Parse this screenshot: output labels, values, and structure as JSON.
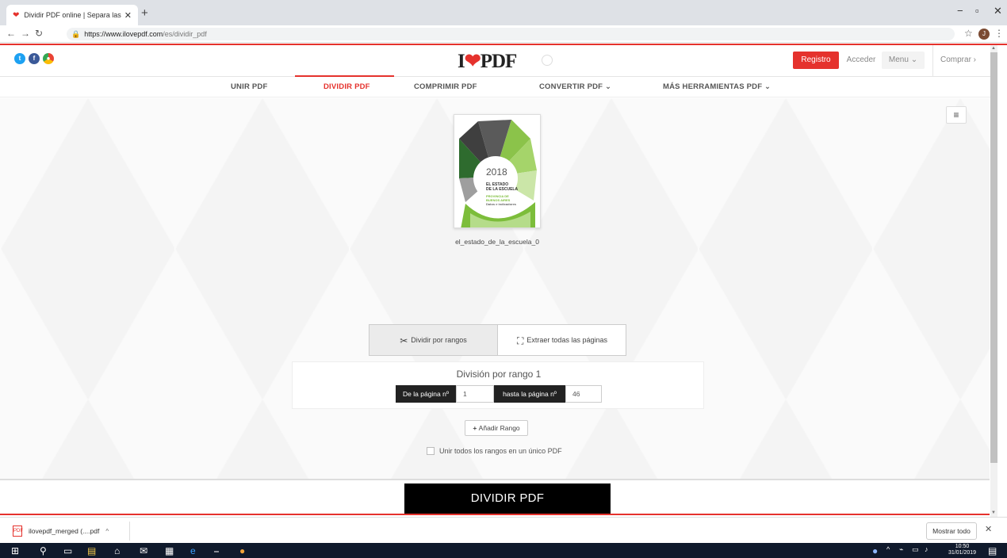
{
  "browser": {
    "tab_title": "Dividir PDF online | Separa las pá",
    "tab_close": "✕",
    "new_tab": "+",
    "url_host": "https://www.ilovepdf.com",
    "url_path": "/es/dividir_pdf"
  },
  "header": {
    "logo_text": "PDF",
    "logo_prefix": "I",
    "registro": "Registro",
    "acceder": "Acceder",
    "menu": "Menu ⌄",
    "comprar": "Comprar ›"
  },
  "nav": {
    "items": [
      "UNIR PDF",
      "DIVIDIR PDF",
      "COMPRIMIR PDF",
      "CONVERTIR PDF ⌄",
      "MÁS HERRAMIENTAS PDF ⌄"
    ],
    "active": "DIVIDIR PDF"
  },
  "file": {
    "name": "el_estado_de_la_escuela_0",
    "cover_year": "2018",
    "cover_line1": "EL ESTADO",
    "cover_line2": "DE LA ESCUELA",
    "cover_line3": "PROVINCIA DE BUENOS AIRES",
    "cover_line4": "Datos e indicadores"
  },
  "modes": {
    "ranges": "Dividir por rangos",
    "extract": "Extraer todas las páginas"
  },
  "range": {
    "title": "División por rango 1",
    "from_label": "De la página nº",
    "from_value": "1",
    "to_label": "hasta la página nº",
    "to_value": "46"
  },
  "actions": {
    "add_range": "Añadir Rango",
    "merge_label": "Unir todos los rangos en un único PDF",
    "divide": "DIVIDIR PDF"
  },
  "downloads": {
    "item": "ilovepdf_merged (....pdf",
    "show_all": "Mostrar todo"
  },
  "taskbar": {
    "time": "10:50",
    "date": "31/01/2019"
  },
  "colors": {
    "brand_red": "#e5322d",
    "brand_green": "#7cbd3a",
    "black": "#000000"
  }
}
